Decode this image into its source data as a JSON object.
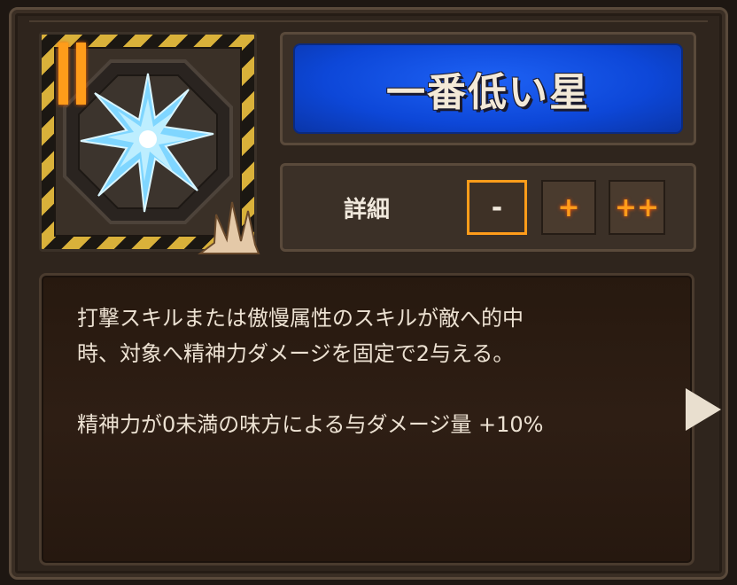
{
  "skill": {
    "name": "一番低い星",
    "icon": "blue-star-crystal-icon",
    "sin_mark": "orange-double-bar-icon",
    "type_icon": "claw-slash-icon"
  },
  "detail": {
    "label": "詳細",
    "buttons": [
      {
        "label": "-",
        "active": true
      },
      {
        "label": "+",
        "active": false
      },
      {
        "label": "++",
        "active": false
      }
    ]
  },
  "description": {
    "lines": [
      "打撃スキルまたは傲慢属性のスキルが敵へ的中",
      "時、対象へ精神力ダメージを固定で2与える。",
      "精神力が0未満の味方による与ダメージ量 +10%"
    ]
  },
  "colors": {
    "accent_orange": "#ff9c1a",
    "title_blue": "#0d47d8",
    "hazard_yellow": "#d9b13a"
  }
}
